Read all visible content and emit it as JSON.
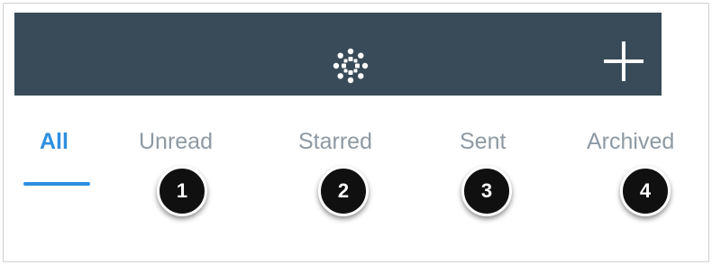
{
  "header": {
    "logo_icon": "canvas-logo-icon",
    "add_icon": "plus-icon",
    "background": "#394b58"
  },
  "tabs": [
    {
      "label": "All",
      "active": true
    },
    {
      "label": "Unread",
      "active": false
    },
    {
      "label": "Starred",
      "active": false
    },
    {
      "label": "Sent",
      "active": false
    },
    {
      "label": "Archived",
      "active": false
    }
  ],
  "badges": [
    "1",
    "2",
    "3",
    "4"
  ],
  "colors": {
    "accent": "#2d8fe0",
    "inactive_tab": "#8e99a3",
    "badge": "#101010"
  }
}
